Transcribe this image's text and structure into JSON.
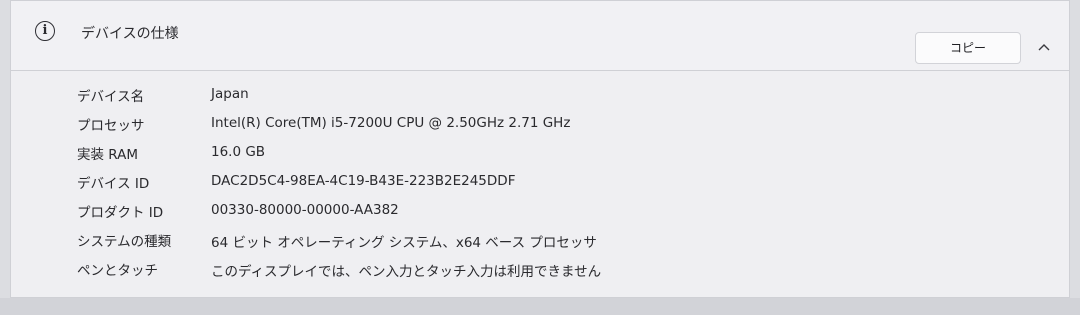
{
  "section": {
    "title": "デバイスの仕様",
    "copy_label": "コピー",
    "icon": "info-icon",
    "collapse_icon": "chevron-up-icon"
  },
  "specs": [
    {
      "label": "デバイス名",
      "value": "Japan"
    },
    {
      "label": "プロセッサ",
      "value": "Intel(R) Core(TM) i5-7200U CPU @ 2.50GHz   2.71 GHz"
    },
    {
      "label": "実装 RAM",
      "value": "16.0 GB"
    },
    {
      "label": "デバイス ID",
      "value": "DAC2D5C4-98EA-4C19-B43E-223B2E245DDF"
    },
    {
      "label": "プロダクト ID",
      "value": "00330-80000-00000-AA382"
    },
    {
      "label": "システムの種類",
      "value": "64 ビット オペレーティング システム、x64 ベース プロセッサ"
    },
    {
      "label": "ペンとタッチ",
      "value": "このディスプレイでは、ペン入力とタッチ入力は利用できません"
    }
  ],
  "colors": {
    "background": "#dcdde1",
    "panel": "#efeff2",
    "button": "#fbfbfc"
  }
}
